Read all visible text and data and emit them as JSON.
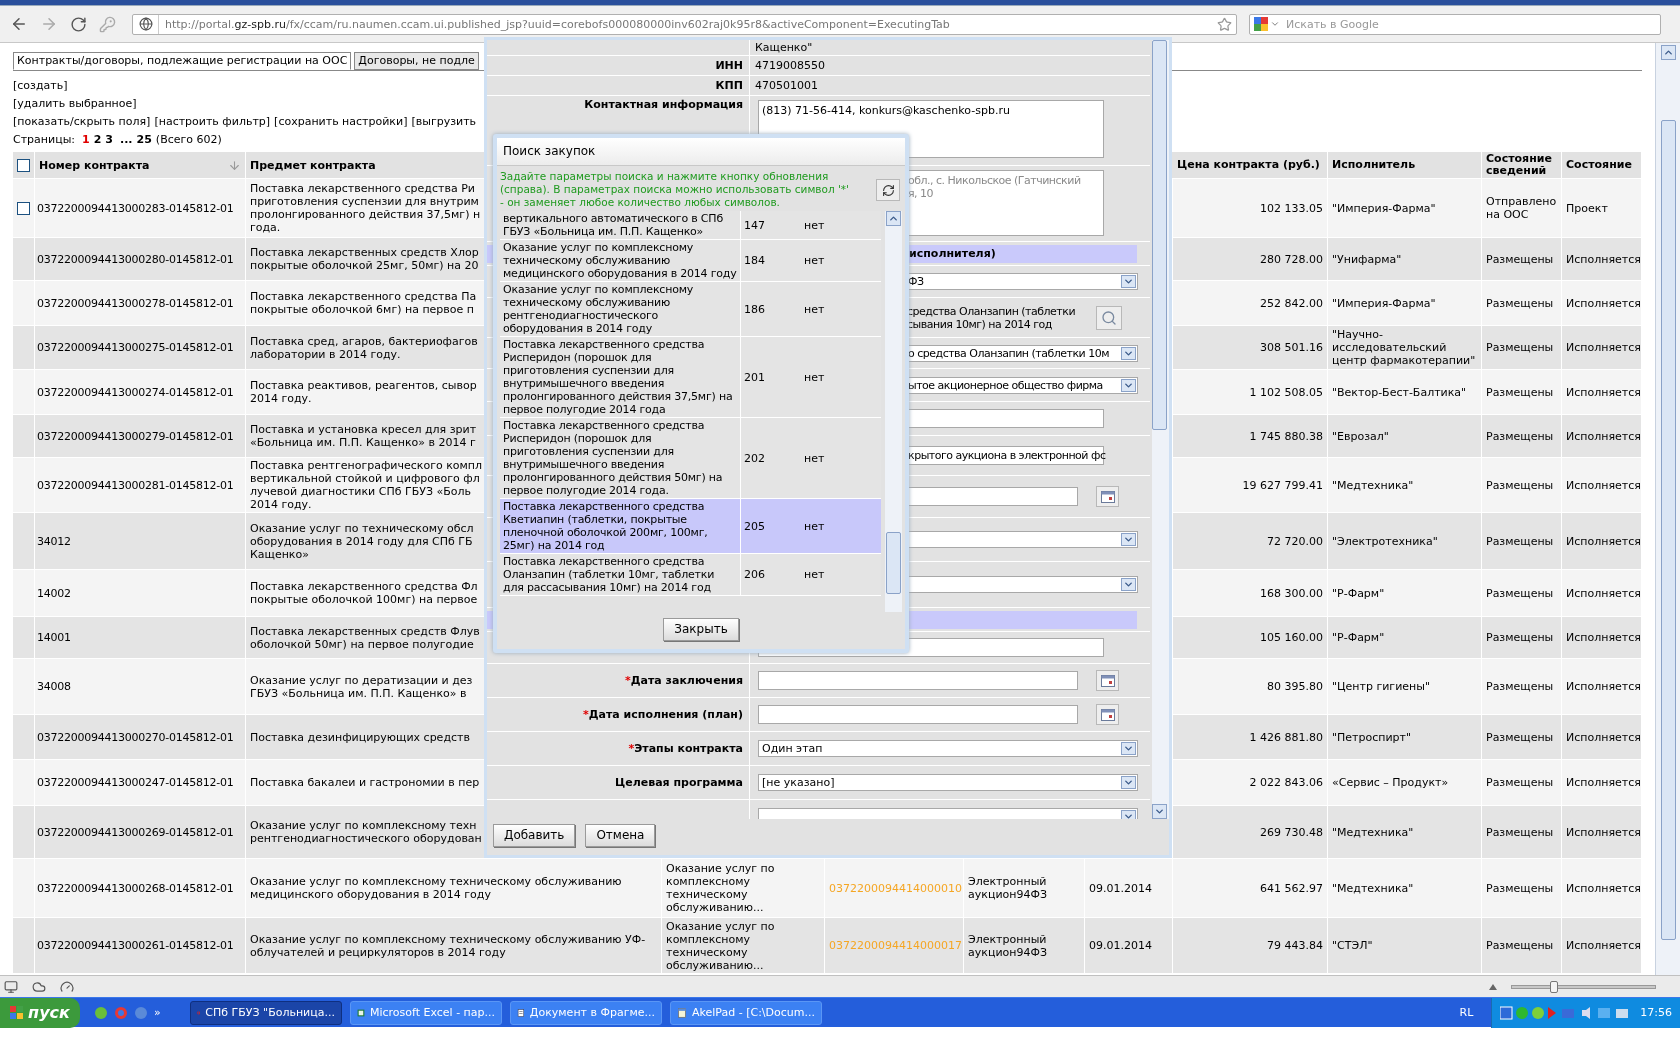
{
  "browser": {
    "url": {
      "prefix": "http://portal.",
      "domain": "gz-spb.ru",
      "path": "/fx/ccam/ru.naumen.ccam.ui.published_jsp?uuid=corebofs000080000inv602raj0k95r8&activeComponent=ExecutingTab"
    },
    "search": {
      "placeholder": "Искать в Google"
    }
  },
  "tabs": [
    {
      "label": "Контракты/договоры, подлежащие регистрации на ООС",
      "selected": true
    },
    {
      "label": "Договоры, не подле",
      "selected": false
    }
  ],
  "actions": [
    "[создать]",
    "[удалить выбранное]"
  ],
  "toolbar_links": [
    "[показать/скрыть поля]",
    "[настроить фильтр]",
    "[сохранить настройки]",
    "[выгрузить"
  ],
  "pagination": {
    "label": "Страницы:",
    "pages": [
      {
        "kind": "page",
        "label": "1",
        "selected": true
      },
      {
        "kind": "page",
        "label": "2",
        "selected": false
      },
      {
        "kind": "page",
        "label": "3",
        "selected": false
      },
      {
        "kind": "gap",
        "label": "..."
      },
      {
        "kind": "page",
        "label": "25",
        "selected": false
      }
    ],
    "total": "(Всего 602)"
  },
  "table": {
    "header_checkbox": {
      "checked": false
    },
    "columns": [
      {
        "label": "Номер контракта",
        "sorted": true
      },
      {
        "label": "Предмет контракта",
        "sorted": false
      },
      {
        "label": "Цена контракта (руб.)",
        "sorted": false
      },
      {
        "label": "Исполнитель",
        "sorted": false
      },
      {
        "label": "Состояние сведений",
        "sorted": false
      },
      {
        "label": "Состояние",
        "sorted": false
      }
    ],
    "rows": [
      {
        "checkbox": {
          "checked": false
        },
        "number": "0372200094413000283-0145812-01",
        "subject": [
          "Поставка лекарственного средства Ри",
          "приготовления суспензии для внутрим",
          "пролонгированного действия 37,5мг) н",
          "года."
        ],
        "price": "102 133.05",
        "executor": "\"Империя-Фарма\"",
        "info_status": "Отправлено на ООС",
        "status": "Проект"
      },
      {
        "number": "0372200094413000280-0145812-01",
        "subject": [
          "Поставка лекарственных средств Хлор",
          "покрытые оболочкой 25мг, 50мг) на 20"
        ],
        "price": "280 728.00",
        "executor": "\"Унифарма\"",
        "info_status": "Размещены",
        "status": "Исполняется"
      },
      {
        "number": "0372200094413000278-0145812-01",
        "subject": [
          "Поставка лекарственного средства Па",
          "покрытые оболочкой 6мг) на первое п"
        ],
        "price": "252 842.00",
        "executor": "\"Империя-Фарма\"",
        "info_status": "Размещены",
        "status": "Исполняется"
      },
      {
        "number": "0372200094413000275-0145812-01",
        "subject": [
          "Поставка сред, агаров, бактериофагов",
          "лаборатории в 2014 году."
        ],
        "price": "308 501.16",
        "executor": "\"Научно-исследовательский центр фармакотерапии\"",
        "info_status": "Размещены",
        "status": "Исполняется"
      },
      {
        "number": "0372200094413000274-0145812-01",
        "subject": [
          "Поставка реактивов, реагентов, сывор",
          "2014 году."
        ],
        "price": "1 102 508.05",
        "executor": "\"Вектор-Бест-Балтика\"",
        "info_status": "Размещены",
        "status": "Исполняется"
      },
      {
        "number": "0372200094413000279-0145812-01",
        "subject": [
          "Поставка и установка кресел для зрит",
          "«Больница им. П.П. Кащенко» в 2014 г"
        ],
        "price": "1 745 880.38",
        "executor": "\"Еврозал\"",
        "info_status": "Размещены",
        "status": "Исполняется"
      },
      {
        "number": "0372200094413000281-0145812-01",
        "subject": [
          "Поставка рентгенографического компл",
          "вертикальной стойкой и цифрового фл",
          "лучевой диагностики СПб ГБУЗ «Боль",
          "2014 году."
        ],
        "price": "19 627 799.41",
        "executor": "\"Медтехника\"",
        "info_status": "Размещены",
        "status": "Исполняется"
      },
      {
        "number": "34012",
        "subject": [
          "Оказание услуг по техническому обсл",
          "оборудования в 2014 году для СПб ГБ",
          "Кащенко»"
        ],
        "price": "72 720.00",
        "executor": "\"Электротехника\"",
        "info_status": "Размещены",
        "status": "Исполняется"
      },
      {
        "number": "14002",
        "subject": [
          "Поставка лекарственного средства Фл",
          "покрытые оболочкой 100мг) на первое"
        ],
        "price": "168 300.00",
        "executor": "\"Р-Фарм\"",
        "info_status": "Размещены",
        "status": "Исполняется"
      },
      {
        "number": "14001",
        "subject": [
          "Поставка лекарственных средств Флув",
          "оболочкой 50мг) на первое полугодие"
        ],
        "price": "105 160.00",
        "executor": "\"Р-Фарм\"",
        "info_status": "Размещены",
        "status": "Исполняется"
      },
      {
        "number": "34008",
        "subject": [
          "Оказание услуг по дератизации и дез",
          "ГБУЗ «Больница им. П.П. Кащенко» в"
        ],
        "price": "80 395.80",
        "executor": "\"Центр гигиены\"",
        "info_status": "Размещены",
        "status": "Исполняется"
      },
      {
        "number": "0372200094413000270-0145812-01",
        "subject": [
          "Поставка дезинфицирующих средств"
        ],
        "price": "1 426 881.80",
        "executor": "\"Петроспирт\"",
        "info_status": "Размещены",
        "status": "Исполняется"
      },
      {
        "number": "0372200094413000247-0145812-01",
        "subject": [
          "Поставка бакалеи и гастрономии в пер"
        ],
        "price": "2 022 843.06",
        "executor": "«Сервис – Продукт»",
        "info_status": "Размещены",
        "status": "Исполняется"
      },
      {
        "number": "0372200094413000269-0145812-01",
        "subject": [
          "Оказание услуг по комплексному техн",
          "рентгенодиагностического оборудован"
        ],
        "price": "269 730.48",
        "executor": "\"Медтехника\"",
        "info_status": "Размещены",
        "status": "Исполняется"
      },
      {
        "number": "0372200094413000268-0145812-01",
        "subject": [
          "Оказание услуг по комплексному техническому обслуживанию",
          "медицинского оборудования в 2014 году"
        ],
        "column_4": "Оказание услуг по комплексному техническому обслуживанию...",
        "column_5": "0372200094414000010",
        "column_6": "Электронный аукцион94ФЗ",
        "column_7": "09.01.2014",
        "price": "641 562.97",
        "executor": "\"Медтехника\"",
        "info_status": "Размещены",
        "status": "Исполняется"
      },
      {
        "number": "0372200094413000261-0145812-01",
        "subject": [
          "Оказание услуг по комплексному техническому обслуживанию УФ-",
          "облучателей и рециркуляторов в 2014 году"
        ],
        "column_4": "Оказание услуг по комплексному техническому обслуживанию...",
        "column_5": "0372200094414000017",
        "column_6": "Электронный аукцион94ФЗ",
        "column_7": "09.01.2014",
        "price": "79 443.84",
        "executor": "\"СТЭЛ\"",
        "info_status": "Размещены",
        "status": "Исполняется"
      }
    ]
  },
  "contract_form": {
    "fields": [
      {
        "kind": "text",
        "value": "Кащенко\""
      },
      {
        "kind": "text",
        "label": "ИНН",
        "value": "4719008550"
      },
      {
        "kind": "text",
        "label": "КПП",
        "value": "470501001"
      },
      {
        "kind": "textarea",
        "label": "Контактная информация",
        "lines": [
          "(813) 71-56-414, konkurs@kaschenko-spb.ru"
        ]
      },
      {
        "kind": "textarea",
        "lines": [
          "обл., с. Никольское (Гатчинский",
          "я, 10"
        ]
      },
      {
        "kind": "section",
        "value": "исполнителя)"
      },
      {
        "kind": "select",
        "value": "ФЗ"
      },
      {
        "kind": "lookup",
        "lines": [
          "средства Оланзапин (таблетки",
          "сывания 10мг) на 2014 год"
        ]
      },
      {
        "kind": "select",
        "value": "о средства Оланзапин (таблетки 10м"
      },
      {
        "kind": "select",
        "value": "ытое акционерное общество фирма"
      },
      {
        "kind": "input"
      },
      {
        "kind": "input",
        "value": "крытого аукциона в электронной фс"
      },
      {
        "kind": "date"
      },
      {
        "kind": "select"
      },
      {
        "kind": "select"
      },
      {
        "kind": "section"
      },
      {
        "kind": "input"
      },
      {
        "kind": "date",
        "label": "Дата заключения",
        "required": true
      },
      {
        "kind": "date",
        "label": "Дата исполнения (план)",
        "required": true
      },
      {
        "kind": "select",
        "label": "Этапы контракта",
        "required": true,
        "value": "Один этап"
      },
      {
        "kind": "select",
        "label": "Целевая программа",
        "required": false,
        "value": "[не указано]"
      },
      {
        "kind": "select"
      }
    ],
    "required_mark": "*",
    "buttons": [
      "Добавить",
      "Отмена"
    ]
  },
  "purchase_search": {
    "title": "Поиск закупок",
    "hint": [
      "Задайте параметры поиска и нажмите кнопку обновления",
      "(справа). В параметрах поиска можно использовать символ '*'",
      "- он заменяет любое количество любых символов."
    ],
    "items": [
      {
        "text": "вертикального автоматического в СПб ГБУЗ «Больница им. П.П. Кащенко»",
        "number": "147",
        "flag": "нет",
        "selected": false
      },
      {
        "text": "Оказание услуг по комплексному техническому обслуживанию медицинского оборудования в 2014 году",
        "number": "184",
        "flag": "нет",
        "selected": false
      },
      {
        "text": "Оказание услуг по комплексному техническому обслуживанию рентгенодиагностического оборудования в 2014 году",
        "number": "186",
        "flag": "нет",
        "selected": false
      },
      {
        "text": "Поставка лекарственного средства Рисперидон (порошок для приготовления суспензии для внутримышечного введения пролонгированного действия 37,5мг) на первое полугодие 2014 года",
        "number": "201",
        "flag": "нет",
        "selected": false
      },
      {
        "text": "Поставка лекарственного средства Рисперидон (порошок для приготовления суспензии для внутримышечного введения пролонгированного действия 50мг) на первое полугодие 2014 года.",
        "number": "202",
        "flag": "нет",
        "selected": false
      },
      {
        "text": "Поставка лекарственного средства Кветиапин (таблетки, покрытые пленочной оболочкой 200мг, 100мг, 25мг) на 2014 год",
        "number": "205",
        "flag": "нет",
        "selected": true
      },
      {
        "text": "Поставка лекарственного средства Оланзапин (таблетки 10мг, таблетки для рассасывания 10мг) на 2014 год",
        "number": "206",
        "flag": "нет",
        "selected": false
      }
    ],
    "close_button": "Закрыть"
  },
  "status_bar": {
    "zoom_slider": {
      "level": 0.28
    }
  },
  "taskbar": {
    "start": "пуск",
    "quicklaunch_more": "»",
    "tasks": [
      {
        "kind": "browser",
        "label": "СПб ГБУЗ \"Больница...",
        "selected": true
      },
      {
        "kind": "spreadsheet",
        "label": "Microsoft Excel - пар...",
        "selected": false
      },
      {
        "kind": "document",
        "label": "Документ в Фрагме...",
        "selected": false
      },
      {
        "kind": "notepad",
        "label": "AkelPad - [C:\\Docum...",
        "selected": false
      }
    ],
    "language": "RL",
    "clock": "17:56"
  }
}
